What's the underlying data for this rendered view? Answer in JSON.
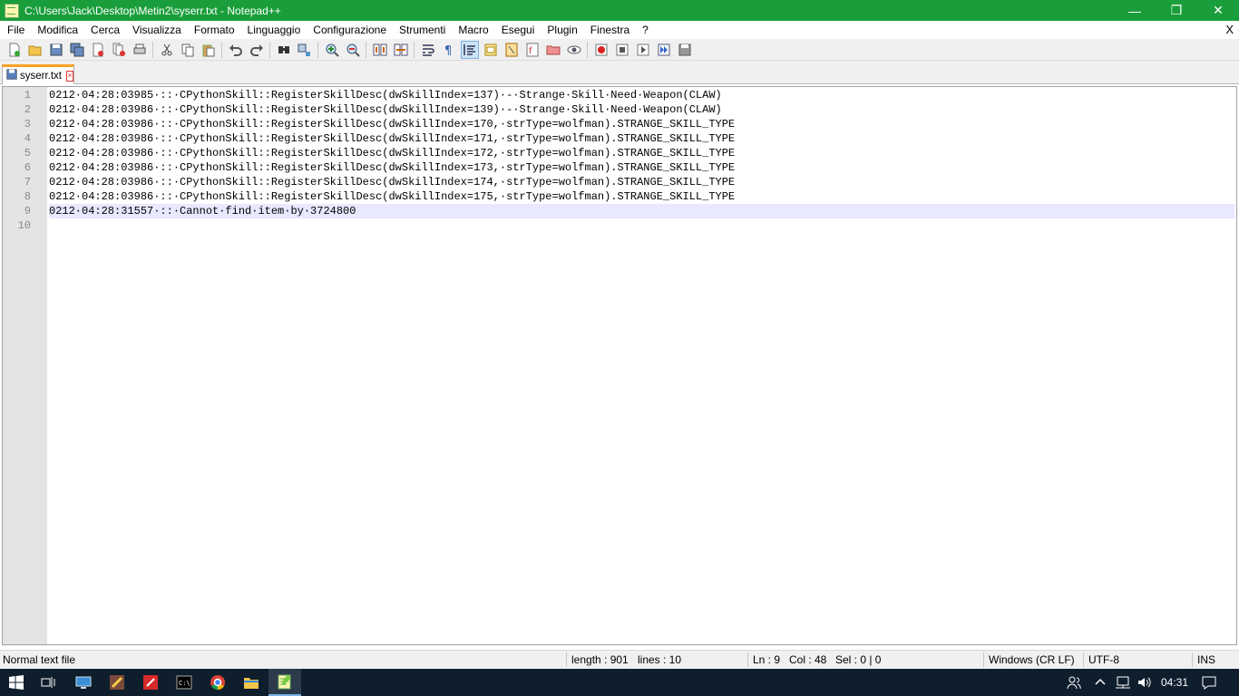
{
  "window": {
    "title": "C:\\Users\\Jack\\Desktop\\Metin2\\syserr.txt - Notepad++",
    "minimize": "—",
    "restore": "❐",
    "close": "✕"
  },
  "menu": {
    "items": [
      "File",
      "Modifica",
      "Cerca",
      "Visualizza",
      "Formato",
      "Linguaggio",
      "Configurazione",
      "Strumenti",
      "Macro",
      "Esegui",
      "Plugin",
      "Finestra",
      "?"
    ],
    "close_doc": "X"
  },
  "tabs": [
    {
      "label": "syserr.txt",
      "close": "×"
    }
  ],
  "editor": {
    "line_numbers": [
      "1",
      "2",
      "3",
      "4",
      "5",
      "6",
      "7",
      "8",
      "9",
      "10"
    ],
    "current_line_index": 8,
    "lines": [
      "0212·04:28:03985·::·CPythonSkill::RegisterSkillDesc(dwSkillIndex=137)·-·Strange·Skill·Need·Weapon(CLAW)",
      "0212·04:28:03986·::·CPythonSkill::RegisterSkillDesc(dwSkillIndex=139)·-·Strange·Skill·Need·Weapon(CLAW)",
      "0212·04:28:03986·::·CPythonSkill::RegisterSkillDesc(dwSkillIndex=170,·strType=wolfman).STRANGE_SKILL_TYPE",
      "0212·04:28:03986·::·CPythonSkill::RegisterSkillDesc(dwSkillIndex=171,·strType=wolfman).STRANGE_SKILL_TYPE",
      "0212·04:28:03986·::·CPythonSkill::RegisterSkillDesc(dwSkillIndex=172,·strType=wolfman).STRANGE_SKILL_TYPE",
      "0212·04:28:03986·::·CPythonSkill::RegisterSkillDesc(dwSkillIndex=173,·strType=wolfman).STRANGE_SKILL_TYPE",
      "0212·04:28:03986·::·CPythonSkill::RegisterSkillDesc(dwSkillIndex=174,·strType=wolfman).STRANGE_SKILL_TYPE",
      "0212·04:28:03986·::·CPythonSkill::RegisterSkillDesc(dwSkillIndex=175,·strType=wolfman).STRANGE_SKILL_TYPE",
      "0212·04:28:31557·::·Cannot·find·item·by·3724800",
      ""
    ]
  },
  "status": {
    "file_type": "Normal text file",
    "length": "length : 901",
    "lines": "lines : 10",
    "ln": "Ln : 9",
    "col": "Col : 48",
    "sel": "Sel : 0 | 0",
    "eol": "Windows (CR LF)",
    "encoding": "UTF-8",
    "mode": "INS"
  },
  "taskbar": {
    "clock": "04:31",
    "apps": [
      "start-icon",
      "task-view-icon",
      "computer-icon",
      "paint-icon",
      "pdf-icon",
      "cmd-icon",
      "chrome-icon",
      "file-explorer-icon",
      "notepadpp-icon"
    ]
  },
  "colors": {
    "titlebar": "#1a9e3b",
    "tab_accent": "#f9a126",
    "current_line": "#e8e8ff",
    "taskbar": "#0f1e2d"
  }
}
